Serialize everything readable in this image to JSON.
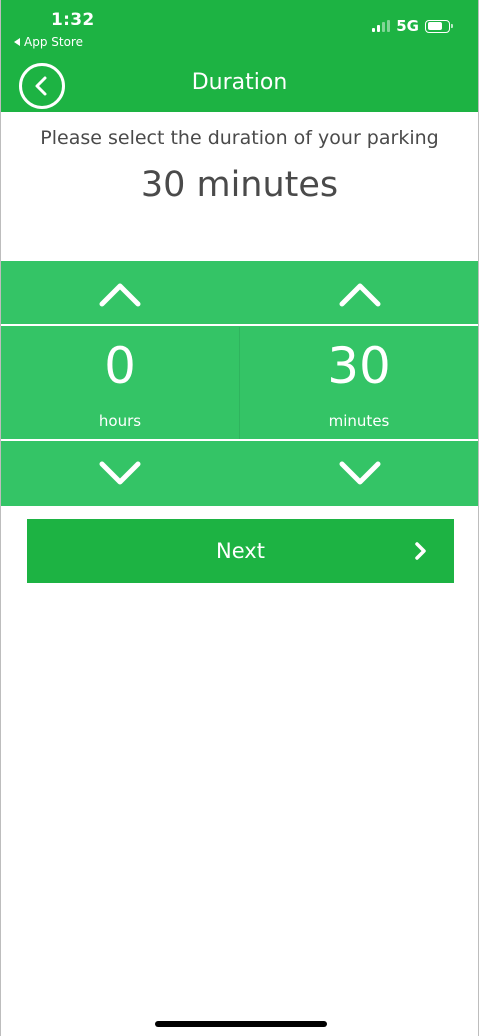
{
  "status_bar": {
    "time": "1:32",
    "back_app": "App Store",
    "network": "5G"
  },
  "nav": {
    "title": "Duration",
    "back_icon": "back-circle-icon"
  },
  "prompt": "Please select the duration of your parking",
  "summary": "30 minutes",
  "picker": {
    "hours": {
      "value": "0",
      "unit": "hours"
    },
    "minutes": {
      "value": "30",
      "unit": "minutes"
    }
  },
  "next_button": {
    "label": "Next"
  },
  "colors": {
    "primary": "#1db343",
    "picker_bg": "#34c466",
    "text": "#4a4a4a"
  }
}
